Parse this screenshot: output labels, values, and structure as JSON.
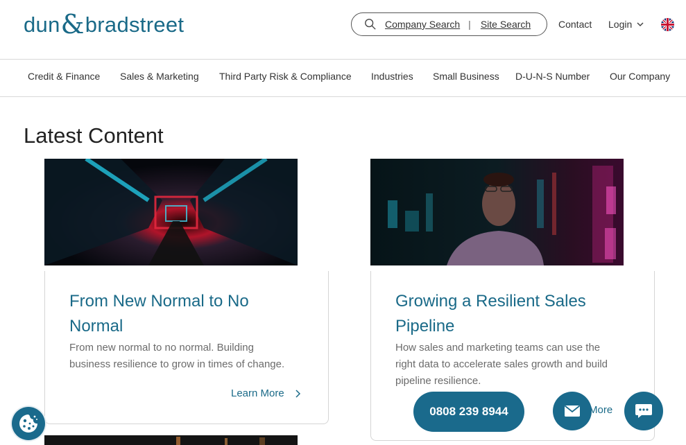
{
  "header": {
    "logo_left": "dun",
    "logo_amp": "&",
    "logo_right": "bradstreet",
    "company_search": "Company Search",
    "separator": "|",
    "site_search": "Site Search",
    "contact": "Contact",
    "login": "Login"
  },
  "nav": {
    "items": [
      "Credit & Finance",
      "Sales & Marketing",
      "Third Party Risk & Compliance",
      "Industries",
      "Small Business",
      "D-U-N-S Number",
      "Our Company"
    ]
  },
  "main": {
    "section_title": "Latest Content",
    "cards": [
      {
        "title_line1": "From New Normal to No",
        "title_line2": "Normal",
        "desc_line1": "From new normal to no normal. Building",
        "desc_line2": "business resilience to grow in times of change.",
        "learn_more": "Learn More"
      },
      {
        "title_line1": "Growing a Resilient Sales",
        "title_line2": "Pipeline",
        "desc_line1": "How sales and marketing teams can use the",
        "desc_line2": "right data to accelerate sales growth and build",
        "desc_line3": "pipeline resilience.",
        "learn_more_partial": "More"
      }
    ]
  },
  "floating": {
    "phone": "0808 239 8944"
  },
  "icons": {
    "search": "search-icon",
    "login_chevron": "chevron-down-icon",
    "flag": "uk-flag-icon",
    "learn_arrow": "chevron-right-icon",
    "email": "mail-icon",
    "chat": "chat-icon",
    "cookie": "cookie-icon"
  },
  "colors": {
    "brand": "#1a6a88",
    "button": "#1a6a8c",
    "text": "#333333",
    "muted": "#6b6b6b"
  }
}
